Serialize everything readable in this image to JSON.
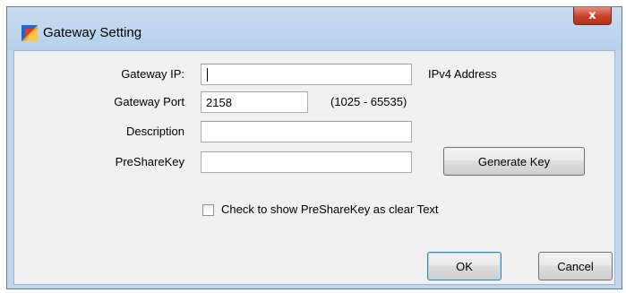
{
  "window": {
    "title": "Gateway Setting",
    "close_label": "x"
  },
  "form": {
    "gateway_ip": {
      "label": "Gateway IP:",
      "value": "",
      "hint": "IPv4 Address"
    },
    "gateway_port": {
      "label": "Gateway Port",
      "value": "2158",
      "hint": "(1025 - 65535)"
    },
    "description": {
      "label": "Description",
      "value": ""
    },
    "preshare_key": {
      "label": "PreShareKey",
      "value": ""
    },
    "generate_key_label": "Generate Key",
    "show_key_checkbox": {
      "label": "Check to show PreShareKey as clear Text",
      "checked": false
    }
  },
  "buttons": {
    "ok_label": "OK",
    "cancel_label": "Cancel"
  },
  "icons": {
    "app": "app-icon",
    "close": "close-icon"
  }
}
